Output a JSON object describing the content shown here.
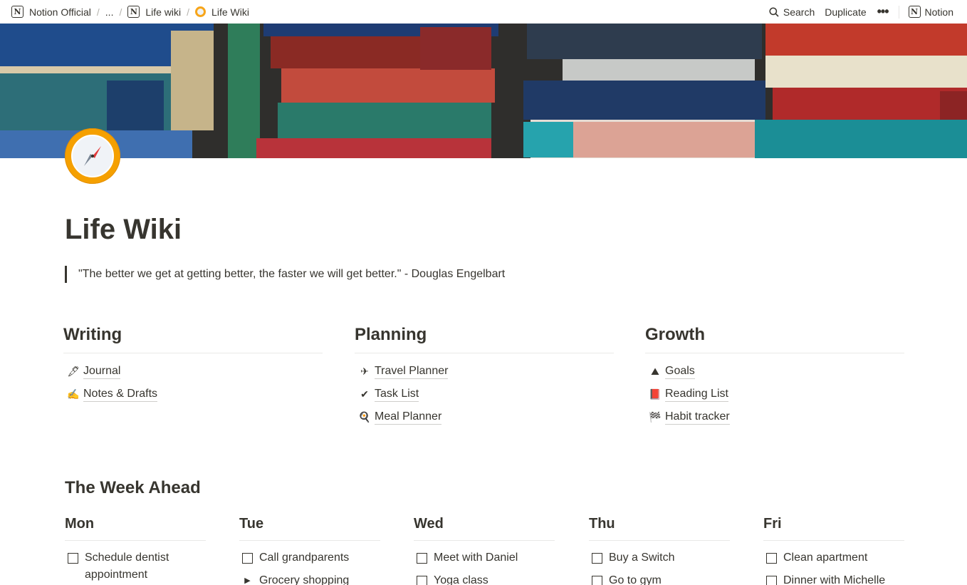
{
  "breadcrumbs": [
    {
      "label": "Notion Official",
      "icon": "notion-logo-icon"
    },
    {
      "label": "...",
      "icon": ""
    },
    {
      "label": "Life wiki",
      "icon": "notion-logo-icon"
    },
    {
      "label": "Life Wiki",
      "icon": "compass-icon"
    }
  ],
  "toolbar": {
    "search_label": "Search",
    "duplicate_label": "Duplicate",
    "more_label": "•••",
    "notion_label": "Notion"
  },
  "page": {
    "title": "Life Wiki",
    "quote": "\"The better we get at getting better, the faster we will get better.\" - Douglas Engelbart"
  },
  "sections": [
    {
      "title": "Writing",
      "items": [
        {
          "label": "Journal",
          "icon": "🖋"
        },
        {
          "label": "Notes & Drafts",
          "icon": "✍"
        }
      ]
    },
    {
      "title": "Planning",
      "items": [
        {
          "label": "Travel Planner",
          "icon": "✈"
        },
        {
          "label": "Task List",
          "icon": "✔"
        },
        {
          "label": "Meal Planner",
          "icon": "🍳"
        }
      ]
    },
    {
      "title": "Growth",
      "items": [
        {
          "label": "Goals",
          "icon": "⛰"
        },
        {
          "label": "Reading List",
          "icon": "📕"
        },
        {
          "label": "Habit tracker",
          "icon": "🏁"
        }
      ]
    }
  ],
  "week": {
    "title": "The Week Ahead",
    "days": [
      {
        "name": "Mon",
        "tasks": [
          {
            "label": "Schedule dentist appointment",
            "type": "todo"
          }
        ]
      },
      {
        "name": "Tue",
        "tasks": [
          {
            "label": "Call grandparents",
            "type": "todo"
          },
          {
            "label": "Grocery shopping",
            "type": "toggle"
          }
        ]
      },
      {
        "name": "Wed",
        "tasks": [
          {
            "label": "Meet with Daniel",
            "type": "todo"
          },
          {
            "label": "Yoga class",
            "type": "todo"
          }
        ]
      },
      {
        "name": "Thu",
        "tasks": [
          {
            "label": "Buy a Switch",
            "type": "todo"
          },
          {
            "label": "Go to gym",
            "type": "todo"
          }
        ]
      },
      {
        "name": "Fri",
        "tasks": [
          {
            "label": "Clean apartment",
            "type": "todo"
          },
          {
            "label": "Dinner with Michelle",
            "type": "todo"
          }
        ]
      }
    ]
  },
  "colors": {
    "text": "#37352f",
    "accent_icon": "#f5a000",
    "divider": "#e9e9e7"
  }
}
